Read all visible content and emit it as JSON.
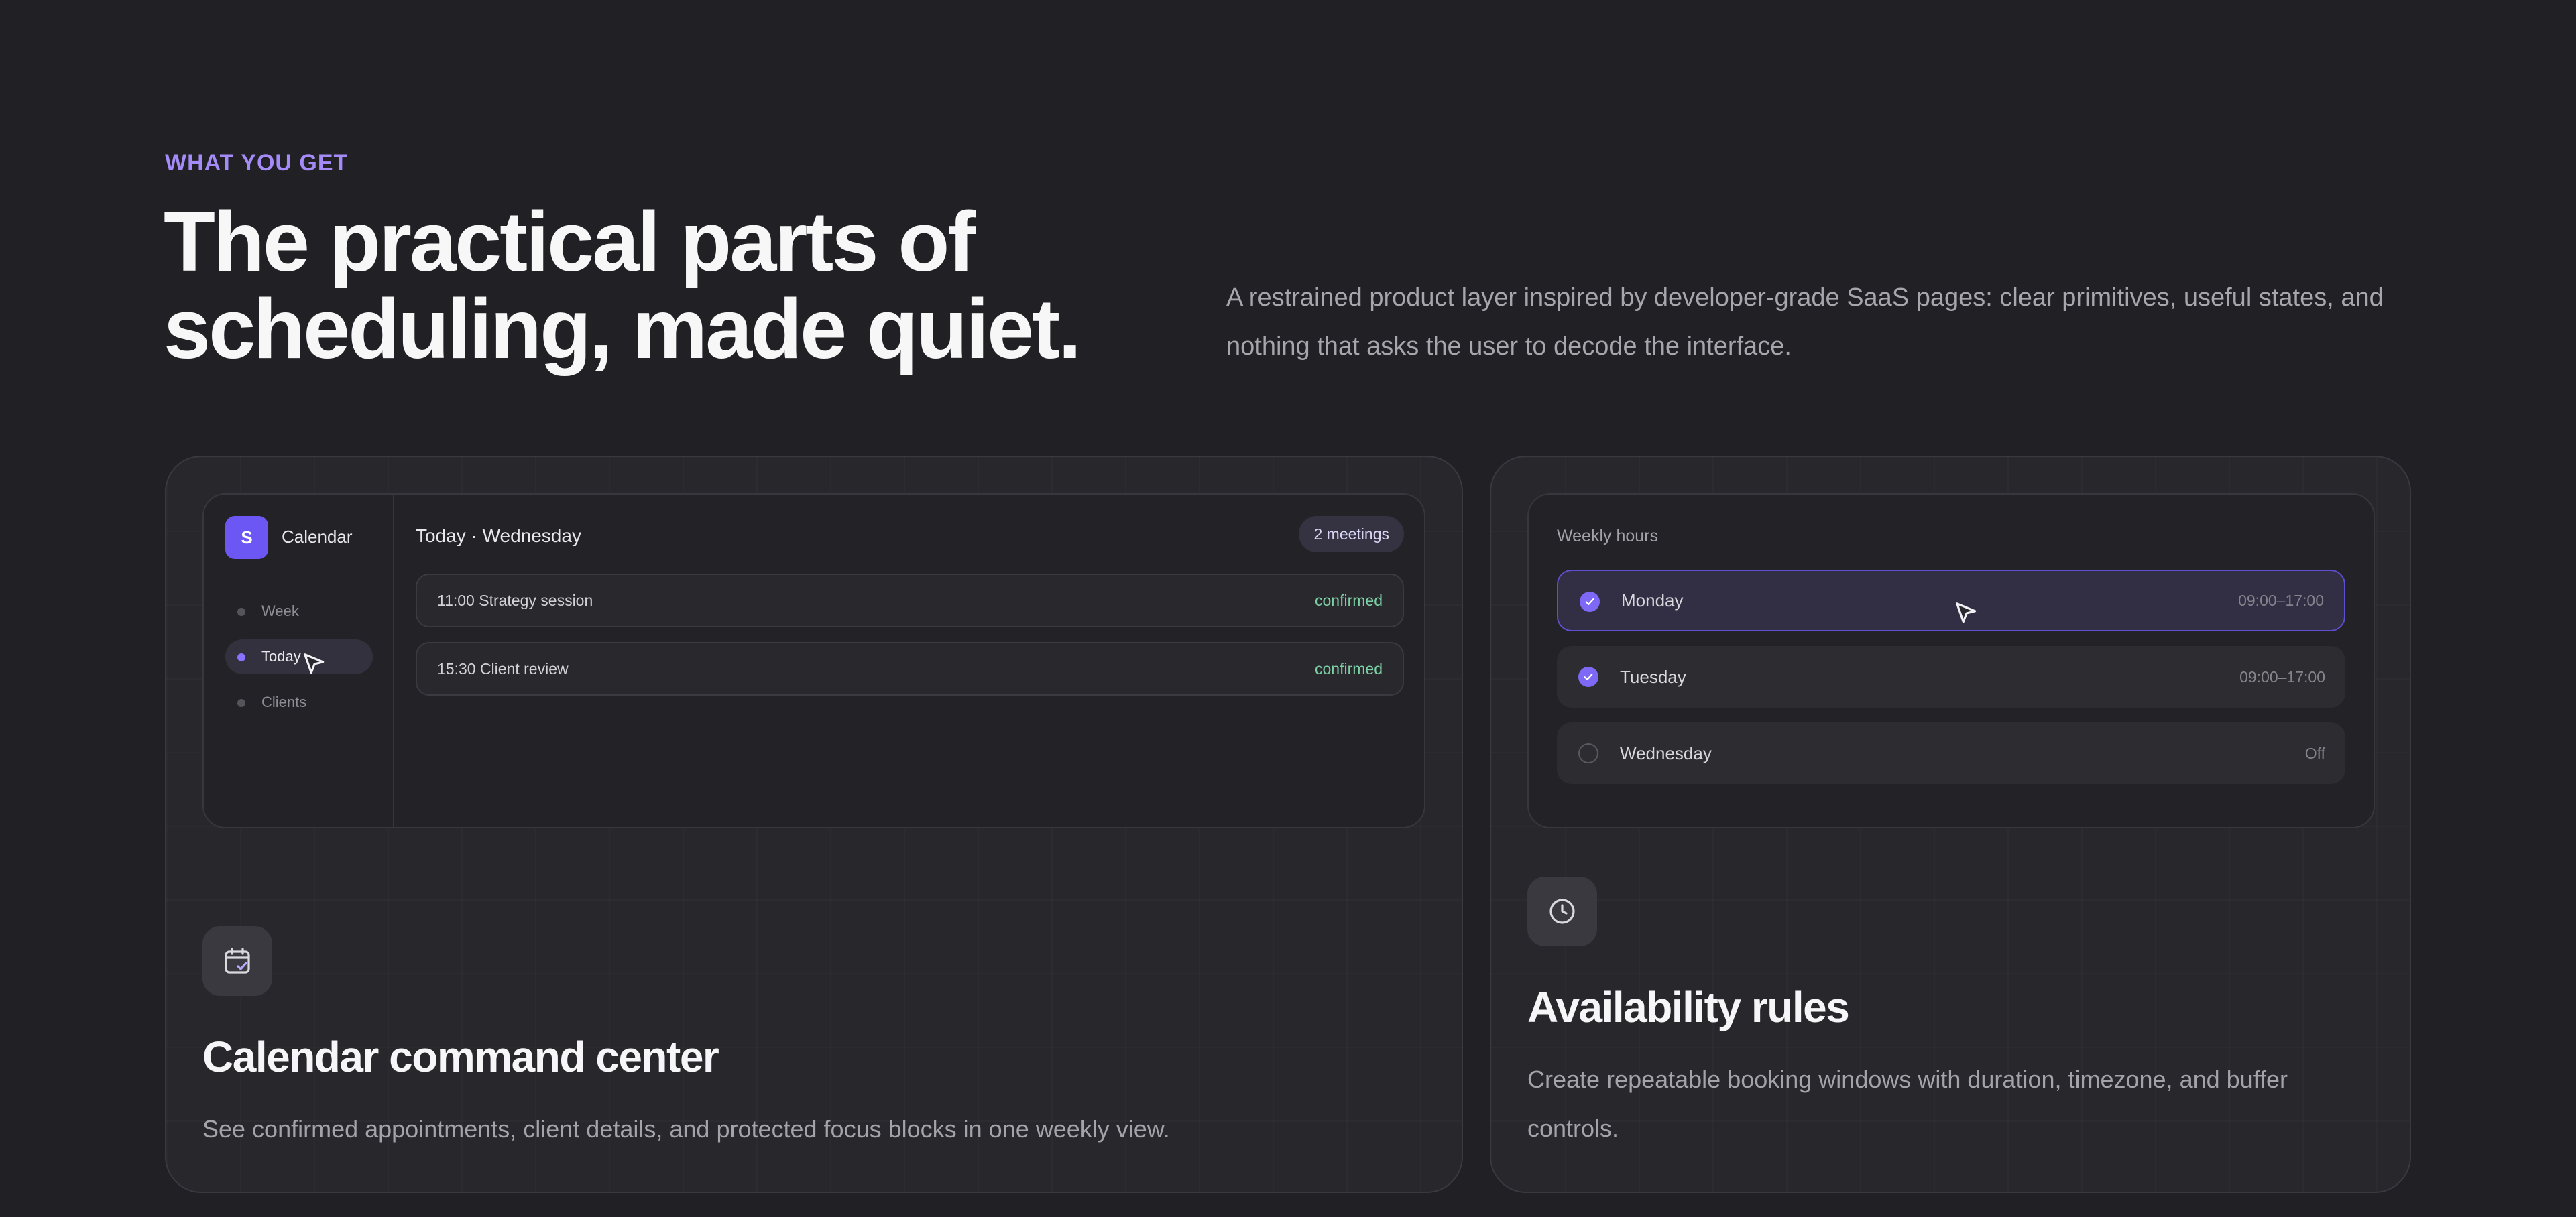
{
  "section": {
    "eyebrow": "WHAT YOU GET",
    "headline_line1": "The practical parts of",
    "headline_line2": "scheduling, made quiet.",
    "lede": "A restrained product layer inspired by developer-grade SaaS pages: clear primitives, useful states, and nothing that asks the user to decode the interface."
  },
  "calendar_card": {
    "mock": {
      "logo_letter": "S",
      "app_name": "Calendar",
      "nav": [
        {
          "label": "Week",
          "active": false
        },
        {
          "label": "Today",
          "active": true
        },
        {
          "label": "Clients",
          "active": false
        }
      ],
      "main_title": "Today · Wednesday",
      "badge": "2 meetings",
      "events": [
        {
          "label": "11:00 Strategy session",
          "status": "confirmed"
        },
        {
          "label": "15:30 Client review",
          "status": "confirmed"
        }
      ]
    },
    "icon": "calendar-check-icon",
    "title": "Calendar command center",
    "description": "See confirmed appointments, client details, and protected focus blocks in one weekly view."
  },
  "availability_card": {
    "mock": {
      "title": "Weekly hours",
      "days": [
        {
          "label": "Monday",
          "hours": "09:00–17:00",
          "enabled": true,
          "selected": true
        },
        {
          "label": "Tuesday",
          "hours": "09:00–17:00",
          "enabled": true,
          "selected": false
        },
        {
          "label": "Wednesday",
          "hours": "Off",
          "enabled": false,
          "selected": false
        }
      ]
    },
    "icon": "clock-icon",
    "title": "Availability rules",
    "description": "Create repeatable booking windows with duration, timezone, and buffer controls."
  },
  "colors": {
    "background": "#212024",
    "accent": "#7e69f6",
    "eyebrow": "#a48bf7",
    "confirmed": "#7bd0a5"
  }
}
